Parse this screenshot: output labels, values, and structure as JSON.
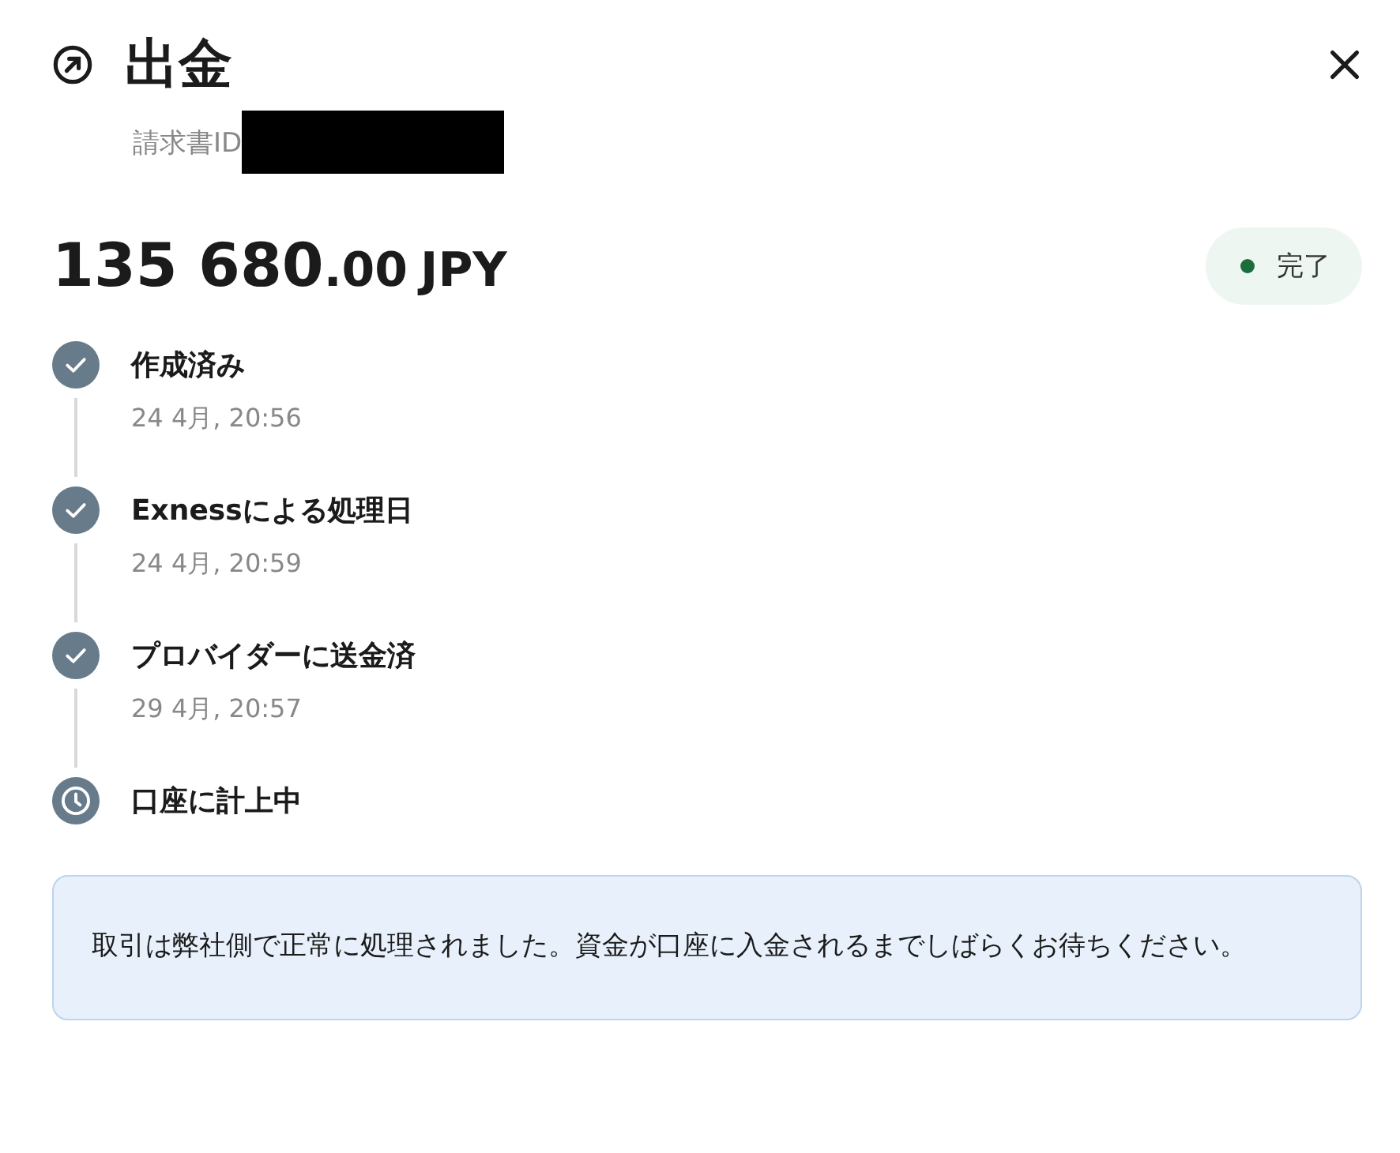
{
  "header": {
    "title": "出金",
    "invoice_label": "請求書ID"
  },
  "amount": {
    "integer": "135 680",
    "decimal": ".00",
    "currency": "JPY"
  },
  "status": {
    "label": "完了"
  },
  "steps": [
    {
      "kind": "done",
      "label": "作成済み",
      "time": "24 4月, 20:56"
    },
    {
      "kind": "done",
      "label": "Exnessによる処理日",
      "time": "24 4月, 20:59"
    },
    {
      "kind": "done",
      "label": "プロバイダーに送金済",
      "time": "29 4月, 20:57"
    },
    {
      "kind": "pending",
      "label": "口座に計上中"
    }
  ],
  "notice": "取引は弊社側で正常に処理されました。資金が口座に入金されるまでしばらくお待ちください。"
}
